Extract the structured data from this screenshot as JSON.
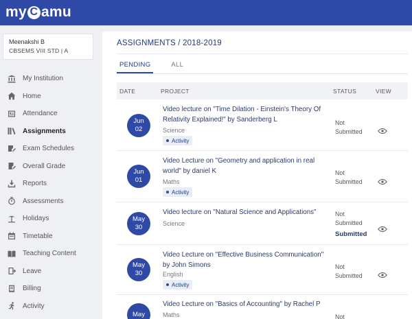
{
  "app": {
    "logo_left": "my",
    "logo_c": "C",
    "logo_right": "amu"
  },
  "profile": {
    "name": "Meenakshi B",
    "class_info": "CBSEMS  VIII  STD   | A"
  },
  "sidebar": {
    "items": [
      {
        "label": "My Institution",
        "icon": "institution-icon",
        "active": false
      },
      {
        "label": "Home",
        "icon": "home-icon",
        "active": false
      },
      {
        "label": "Attendance",
        "icon": "attendance-icon",
        "active": false
      },
      {
        "label": "Assignments",
        "icon": "assignments-icon",
        "active": true
      },
      {
        "label": "Exam Schedules",
        "icon": "exam-schedule-icon",
        "active": false
      },
      {
        "label": "Overall Grade",
        "icon": "grade-icon",
        "active": false
      },
      {
        "label": "Reports",
        "icon": "download-icon",
        "active": false
      },
      {
        "label": "Assessments",
        "icon": "timer-icon",
        "active": false
      },
      {
        "label": "Holidays",
        "icon": "holiday-icon",
        "active": false
      },
      {
        "label": "Timetable",
        "icon": "calendar-icon",
        "active": false
      },
      {
        "label": "Teaching Content",
        "icon": "book-icon",
        "active": false
      },
      {
        "label": "Leave",
        "icon": "leave-icon",
        "active": false
      },
      {
        "label": "Billing",
        "icon": "billing-icon",
        "active": false
      },
      {
        "label": "Activity",
        "icon": "running-icon",
        "active": false
      }
    ]
  },
  "main": {
    "title": "ASSIGNMENTS / 2018-2019",
    "tabs": [
      {
        "label": "PENDING",
        "active": true
      },
      {
        "label": "ALL",
        "active": false
      }
    ],
    "columns": {
      "date": "DATE",
      "project": "PROJECT",
      "status": "STATUS",
      "view": "VIEW"
    },
    "rows": [
      {
        "month": "Jun",
        "day": "02",
        "title": "Video lecture on \"Time Dilation - Einstein's Theory Of Relativity Explained!\" by Sanderberg L",
        "subject": "Science",
        "tag": "Activity",
        "status": "Not Submitted",
        "extra_status": ""
      },
      {
        "month": "Jun",
        "day": "01",
        "title": "Video Lecture on \"Geometry and application in real world\" by daniel K",
        "subject": "Maths",
        "tag": "Activity",
        "status": "Not Submitted",
        "extra_status": ""
      },
      {
        "month": "May",
        "day": "30",
        "title": "Video lecture on \"Natural Science and Applications\"",
        "subject": "Science",
        "tag": "",
        "status": "Not Submitted",
        "extra_status": "Submitted"
      },
      {
        "month": "May",
        "day": "30",
        "title": "Video Lecture on \"Effective Business Communication\" by John Simons",
        "subject": "English",
        "tag": "Activity",
        "status": "Not Submitted",
        "extra_status": ""
      },
      {
        "month": "May",
        "day": "",
        "title": "Video Lecture on \"Basics of Accounting\" by Rachel P",
        "subject": "Maths",
        "tag": "",
        "status": "Not",
        "extra_status": ""
      }
    ]
  },
  "colors": {
    "brand": "#2f4aa6",
    "sidebar_bg": "#eef0f4",
    "title": "#1f3a7a"
  }
}
